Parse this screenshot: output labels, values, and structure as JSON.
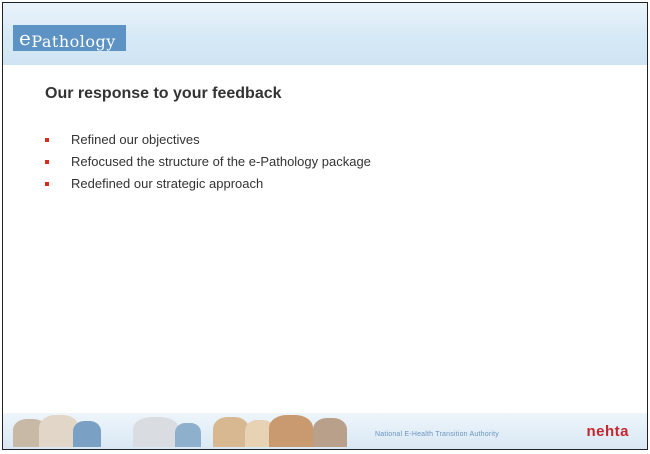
{
  "header": {
    "logo_initial": "e",
    "logo_text": "Pathology"
  },
  "main": {
    "title": "Our response to your feedback",
    "bullets": [
      "Refined our objectives",
      "Refocused the structure of the e-Pathology package",
      "Redefined our strategic approach"
    ]
  },
  "footer": {
    "organisation": "National E-Health Transition Authority",
    "brand": "nehta"
  },
  "colors": {
    "bullet": "#d42b1e",
    "brand": "#c4262e",
    "logo_bg": "#5c93c4"
  }
}
